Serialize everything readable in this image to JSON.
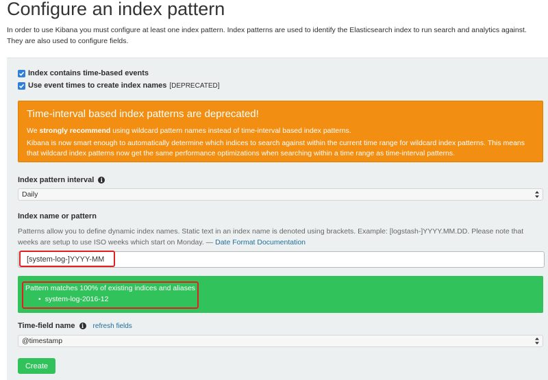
{
  "page": {
    "title": "Configure an index pattern",
    "intro": "In order to use Kibana you must configure at least one index pattern. Index patterns are used to identify the Elasticsearch index to run search and analytics against. They are also used to configure fields."
  },
  "options": {
    "time_based": {
      "label": "Index contains time-based events",
      "checked": true
    },
    "event_times": {
      "label": "Use event times to create index names",
      "suffix": "[DEPRECATED]",
      "checked": true
    }
  },
  "deprecation_alert": {
    "title": "Time-interval based index patterns are deprecated!",
    "line1_prefix": "We ",
    "line1_strong": "strongly recommend",
    "line1_suffix": " using wildcard pattern names instead of time-interval based index patterns.",
    "line2": "Kibana is now smart enough to automatically determine which indices to search against within the current time range for wildcard index patterns. This means that wildcard index patterns now get the same performance optimizations when searching within a time range as time-interval patterns."
  },
  "interval": {
    "label": "Index pattern interval",
    "selected": "Daily"
  },
  "pattern": {
    "label": "Index name or pattern",
    "help": "Patterns allow you to define dynamic index names. Static text in an index name is denoted using brackets. Example: [logstash-]YYYY.MM.DD. Please note that weeks are setup to use ISO weeks which start on Monday. — ",
    "help_link": "Date Format Documentation",
    "value": "[system-log-]YYYY-MM"
  },
  "match_alert": {
    "title": "Pattern matches 100% of existing indices and aliases",
    "items": [
      "system-log-2016-12"
    ]
  },
  "time_field": {
    "label": "Time-field name",
    "refresh_link": "refresh fields",
    "selected": "@timestamp"
  },
  "actions": {
    "create_label": "Create"
  },
  "colors": {
    "warning": "#f28e11",
    "success": "#31c25c",
    "highlight": "#e02020",
    "link": "#1f6e99"
  }
}
